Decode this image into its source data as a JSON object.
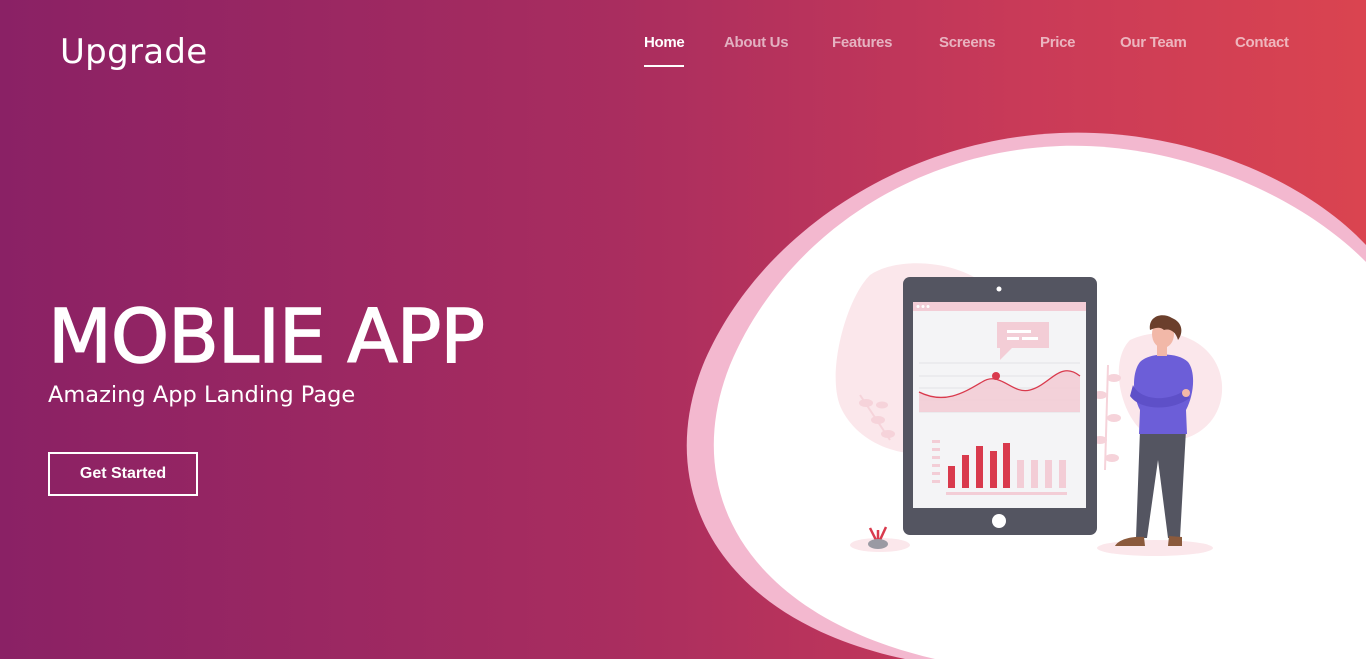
{
  "brand": {
    "logo_text": "Upgrade"
  },
  "nav": {
    "items": [
      {
        "label": "Home",
        "active": true
      },
      {
        "label": "About Us"
      },
      {
        "label": "Features"
      },
      {
        "label": "Screens"
      },
      {
        "label": "Price"
      },
      {
        "label": "Our Team"
      },
      {
        "label": "Contact"
      }
    ]
  },
  "hero": {
    "title": "MOBLIE APP",
    "subtitle": "Amazing App Landing Page",
    "cta_label": "Get Started"
  },
  "illustration": {
    "bars_highlighted": 5,
    "bars_faded": 4
  },
  "colors": {
    "gradient_start": "#8a2165",
    "gradient_end": "#da4450",
    "blob_outer": "#f3b8cf",
    "tablet_frame": "#545561",
    "chart_red": "#d93a4d",
    "chart_pale": "#f3cdd6",
    "person_shirt": "#6c5ed8"
  }
}
